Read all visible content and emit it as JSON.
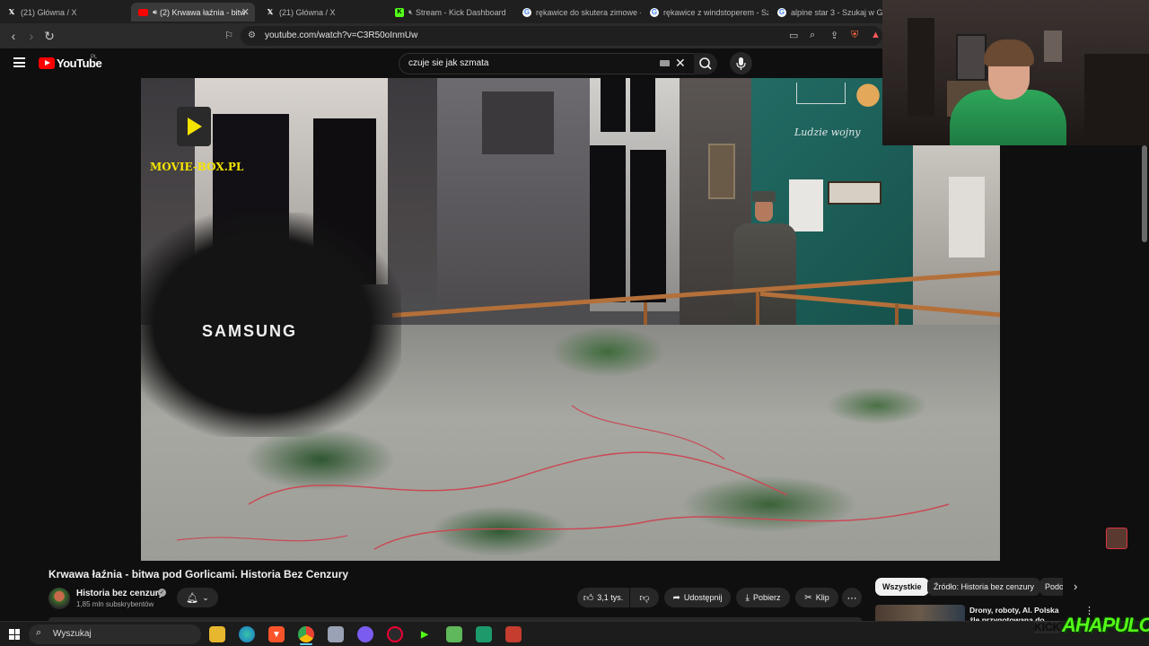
{
  "browser": {
    "tabs": [
      {
        "label": "(21) Główna / X",
        "icon": "x-logo-icon"
      },
      {
        "label": "(2) Krwawa łaźnia - bitw",
        "icon": "youtube-icon",
        "active": true
      },
      {
        "label": "(21) Główna / X",
        "icon": "x-logo-icon"
      },
      {
        "label": "Stream - Kick Dashboard",
        "icon": "kick-icon"
      },
      {
        "label": "rękawice do skutera zimowe -",
        "icon": "google-icon"
      },
      {
        "label": "rękawice z windstoperem - Sz",
        "icon": "google-icon"
      },
      {
        "label": "alpine star 3 - Szukaj w Goog",
        "icon": "google-icon"
      }
    ],
    "url": "youtube.com/watch?v=C3R50oInmUw"
  },
  "youtube": {
    "logo_text": "YouTube",
    "region": "PL",
    "search_value": "czuje sie jak szmata"
  },
  "video": {
    "overlay_brand": "MOVIE-BOX.PL",
    "overlay_samsung": "SAMSUNG",
    "sign_text": "Ludzie wojny"
  },
  "details": {
    "title": "Krwawa łaźnia - bitwa pod Gorlicami. Historia Bez Cenzury",
    "channel_name": "Historia bez cenzury",
    "subscribers": "1,85 mln subskrybentów",
    "likes": "3,1 tys.",
    "share_label": "Udostępnij",
    "download_label": "Pobierz",
    "clip_label": "Klip"
  },
  "sidebar": {
    "chips": [
      "Wszystkie",
      "Źródło: Historia bez cenzury",
      "Podo"
    ],
    "first_video_title": "Drony, roboty, AI. Polska źle przygotowana do wojny XXI"
  },
  "stream_overlay": {
    "kick_text": "KICK",
    "streamer_name": "AHAPULCO"
  },
  "taskbar": {
    "search_placeholder": "Wyszukaj"
  },
  "colors": {
    "yt_red": "#ff0000",
    "overlay_yellow": "#f5e400",
    "kick_green": "#53fc18",
    "background": "#0f0f0f"
  }
}
